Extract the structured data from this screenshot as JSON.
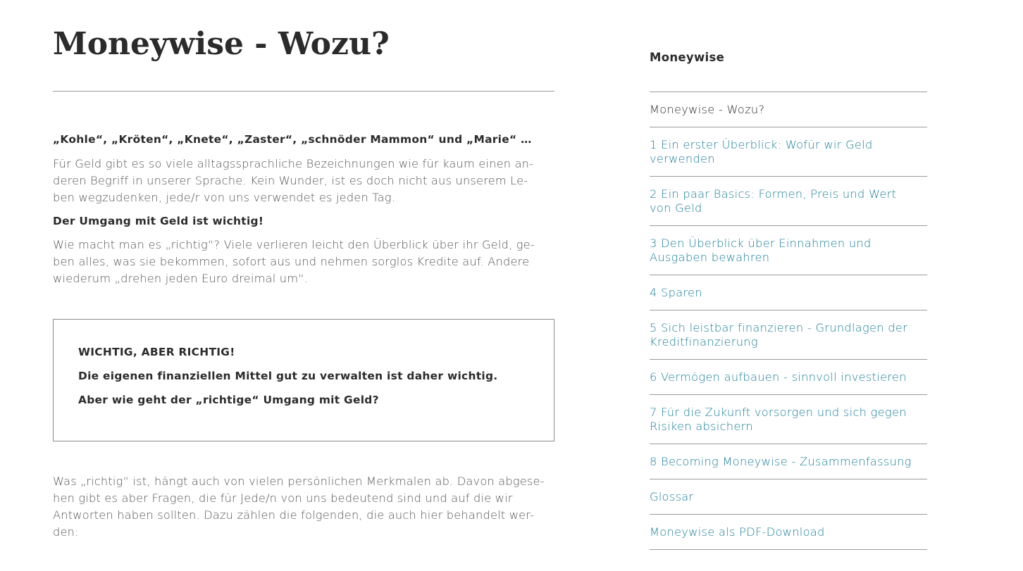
{
  "main": {
    "title": "Moneywise - Wozu?",
    "intro_bold": "„Kohle“, „Kröten“, „Knete“, „Zaster“, „schnöder Mammon“ und „Marie“ …",
    "para1_lines": [
      "Für Geld gibt es so viele alltagssprachliche Bezeichnungen wie für kaum einen an-",
      "deren Begriff in unserer Sprache. Kein Wunder, ist es doch nicht aus unserem Le-",
      "ben wegzudenken, jede/r von uns verwendet es jeden Tag."
    ],
    "subheading": "Der Umgang mit Geld ist wichtig!",
    "para2_lines": [
      "Wie macht man es „richtig“? Viele verlieren leicht den Überblick über ihr Geld, ge-",
      "ben alles, was sie bekommen, sofort aus und nehmen sorglos Kredite auf. Andere",
      "wiederum „drehen jeden Euro dreimal um“."
    ],
    "box": {
      "line1": "WICHTIG, ABER RICHTIG!",
      "line2": "Die eigenen finanziellen Mittel gut zu verwalten ist daher wichtig.",
      "line3": "Aber wie geht der „richtige“ Umgang mit Geld?"
    },
    "para3_lines": [
      "Was „richtig“ ist, hängt auch von vielen persönlichen Merkmalen ab. Davon abgese-",
      "hen gibt es aber Fragen, die für Jede/n von uns bedeutend sind und auf die wir",
      "Antworten haben sollten. Dazu zählen die folgenden, die auch hier behandelt wer-",
      "den:"
    ]
  },
  "sidebar": {
    "heading": "Moneywise",
    "items": [
      {
        "lines": [
          "Moneywise - Wozu?"
        ]
      },
      {
        "lines": [
          "1 Ein erster Überblick: Wofür wir Geld",
          "verwenden"
        ]
      },
      {
        "lines": [
          "2 Ein paar Basics: Formen, Preis und Wert",
          "von Geld"
        ]
      },
      {
        "lines": [
          "3 Den Überblick über Einnahmen und",
          "Ausgaben bewahren"
        ]
      },
      {
        "lines": [
          "4 Sparen"
        ]
      },
      {
        "lines": [
          "5 Sich leistbar finanzieren - Grundlagen der",
          "Kreditfinanzierung"
        ]
      },
      {
        "lines": [
          "6 Vermögen aufbauen - sinnvoll investieren"
        ]
      },
      {
        "lines": [
          "7 Für die Zukunft vorsorgen und sich gegen",
          "Risiken absichern"
        ]
      },
      {
        "lines": [
          "8 Becoming Moneywise - Zusammenfassung"
        ]
      },
      {
        "lines": [
          "Glossar"
        ]
      },
      {
        "lines": [
          "Moneywise als PDF-Download"
        ]
      }
    ]
  },
  "colors": {
    "link": "#1b7f99",
    "text": "#555555",
    "heading": "#2b2b2b",
    "rule": "#9a9a9a"
  }
}
